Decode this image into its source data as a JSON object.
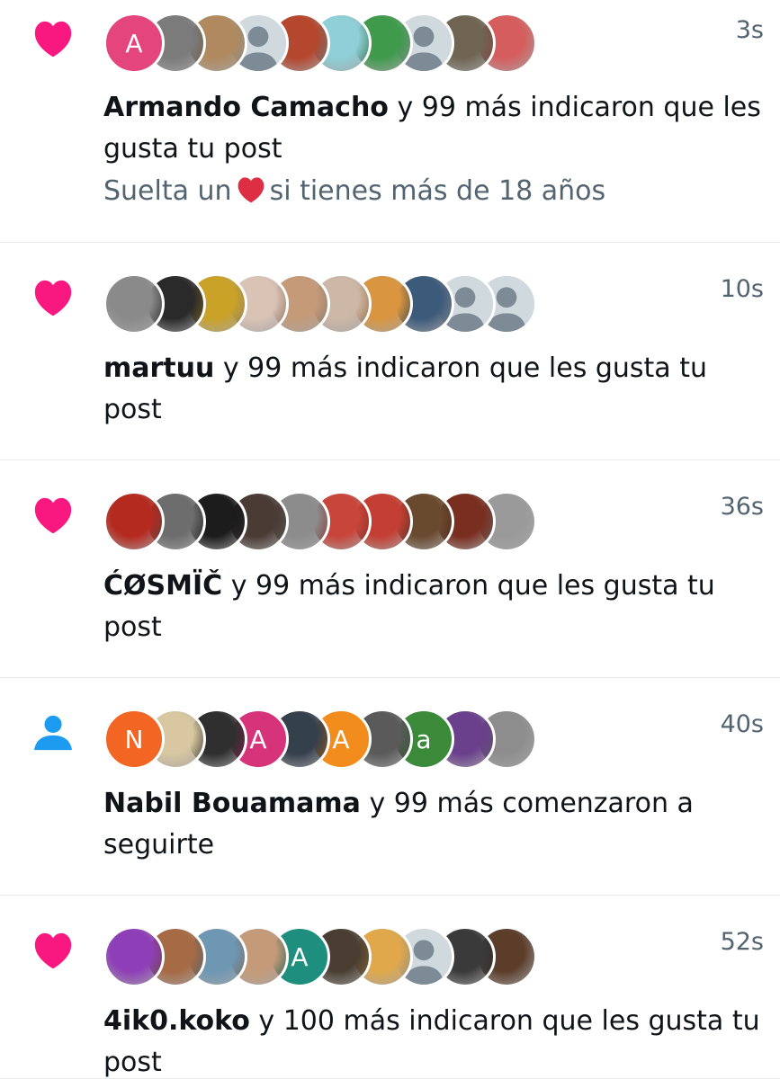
{
  "colors": {
    "like": "#f91880",
    "follow": "#1d9bf0",
    "meta": "#536471",
    "text": "#0f1419",
    "divider": "#e7e9ec"
  },
  "notifications": [
    {
      "type": "like",
      "icon": "heart-icon",
      "actor": "Armando Camacho",
      "action": " y 99 más indicaron que les gusta tu post",
      "preview_before": "Suelta un",
      "preview_emoji": "red-heart-emoji",
      "preview_after": "si tienes más de 18 años",
      "time": "3s",
      "avatars": [
        {
          "kind": "letter",
          "letter": "A",
          "color": "#e3457c"
        },
        {
          "kind": "photo",
          "color": "#7b7b7b"
        },
        {
          "kind": "photo",
          "color": "#b08a5e"
        },
        {
          "kind": "default"
        },
        {
          "kind": "photo",
          "color": "#b4472e"
        },
        {
          "kind": "photo",
          "color": "#8ecfd8"
        },
        {
          "kind": "photo",
          "color": "#3f9a4c"
        },
        {
          "kind": "default"
        },
        {
          "kind": "photo",
          "color": "#6f6552"
        },
        {
          "kind": "photo",
          "color": "#d65d5d"
        }
      ]
    },
    {
      "type": "like",
      "icon": "heart-icon",
      "actor": "martuu",
      "action": " y 99 más indicaron que les gusta tu post",
      "time": "10s",
      "avatars": [
        {
          "kind": "photo",
          "color": "#8a8a8a"
        },
        {
          "kind": "photo",
          "color": "#2a2a2a"
        },
        {
          "kind": "photo",
          "color": "#c9a227"
        },
        {
          "kind": "photo",
          "color": "#d9c3b5"
        },
        {
          "kind": "photo",
          "color": "#c49a79"
        },
        {
          "kind": "photo",
          "color": "#cdb7a6"
        },
        {
          "kind": "photo",
          "color": "#d9953f"
        },
        {
          "kind": "photo",
          "color": "#3c5a7a"
        },
        {
          "kind": "default"
        },
        {
          "kind": "default"
        }
      ]
    },
    {
      "type": "like",
      "icon": "heart-icon",
      "actor": "ĆØSMÏČ",
      "action": " y 99 más indicaron que les gusta tu post",
      "time": "36s",
      "avatars": [
        {
          "kind": "photo",
          "color": "#b52a1f"
        },
        {
          "kind": "photo",
          "color": "#6d6d6d"
        },
        {
          "kind": "photo",
          "color": "#1c1c1c"
        },
        {
          "kind": "photo",
          "color": "#4a3b35"
        },
        {
          "kind": "photo",
          "color": "#8c8c8c"
        },
        {
          "kind": "photo",
          "color": "#c8453a"
        },
        {
          "kind": "photo",
          "color": "#c43f33"
        },
        {
          "kind": "photo",
          "color": "#6a4a2f"
        },
        {
          "kind": "photo",
          "color": "#7a2e1f"
        },
        {
          "kind": "photo",
          "color": "#9a9a9a"
        }
      ]
    },
    {
      "type": "follow",
      "icon": "person-icon",
      "actor": "Nabil Bouamama",
      "action": " y 99 más comenzaron a seguirte",
      "time": "40s",
      "avatars": [
        {
          "kind": "letter",
          "letter": "N",
          "color": "#f26522"
        },
        {
          "kind": "photo",
          "color": "#d8c7a0"
        },
        {
          "kind": "photo",
          "color": "#2f2f2f"
        },
        {
          "kind": "letter",
          "letter": "A",
          "color": "#d6337a"
        },
        {
          "kind": "photo",
          "color": "#35404d"
        },
        {
          "kind": "letter",
          "letter": "A",
          "color": "#f28c1c"
        },
        {
          "kind": "photo",
          "color": "#5a5a5a"
        },
        {
          "kind": "letter",
          "letter": "a",
          "color": "#3a8a3a"
        },
        {
          "kind": "photo",
          "color": "#6a3f8c"
        },
        {
          "kind": "photo",
          "color": "#8d8d8d"
        }
      ]
    },
    {
      "type": "like",
      "icon": "heart-icon",
      "actor": "4ik0.koko",
      "action": " y 100 más indicaron que les gusta tu post",
      "time": "52s",
      "avatars": [
        {
          "kind": "photo",
          "color": "#8e3fb8"
        },
        {
          "kind": "photo",
          "color": "#a66a44"
        },
        {
          "kind": "photo",
          "color": "#6e97b4"
        },
        {
          "kind": "photo",
          "color": "#c59a78"
        },
        {
          "kind": "letter",
          "letter": "A",
          "color": "#1e8f7e"
        },
        {
          "kind": "photo",
          "color": "#4a3e32"
        },
        {
          "kind": "photo",
          "color": "#e0a84a"
        },
        {
          "kind": "default"
        },
        {
          "kind": "photo",
          "color": "#3a3a3a"
        },
        {
          "kind": "photo",
          "color": "#5b3d2a"
        }
      ]
    }
  ]
}
